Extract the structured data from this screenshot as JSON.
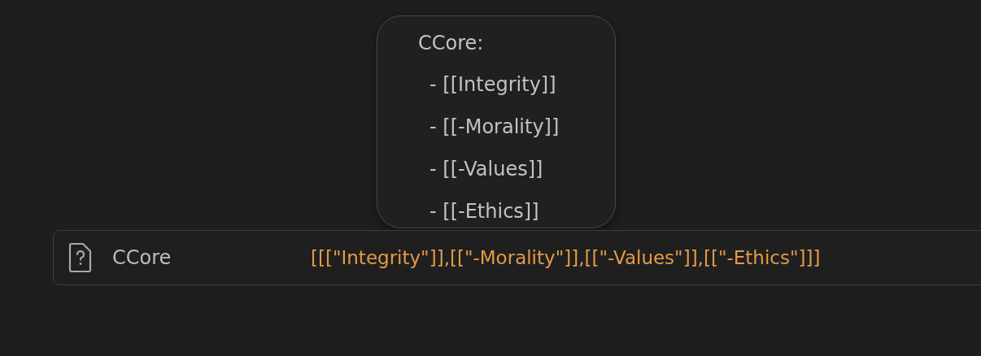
{
  "preview": {
    "title": "CCore:",
    "items": [
      "- [[Integrity]]",
      "- [[-Morality]]",
      "- [[-Values]]",
      "- [[-Ethics]]"
    ]
  },
  "property": {
    "name": "CCore",
    "value": "[[[\"Integrity\"]],[[\"-Morality\"]],[[\"-Values\"]],[[\"-Ethics\"]]]"
  }
}
